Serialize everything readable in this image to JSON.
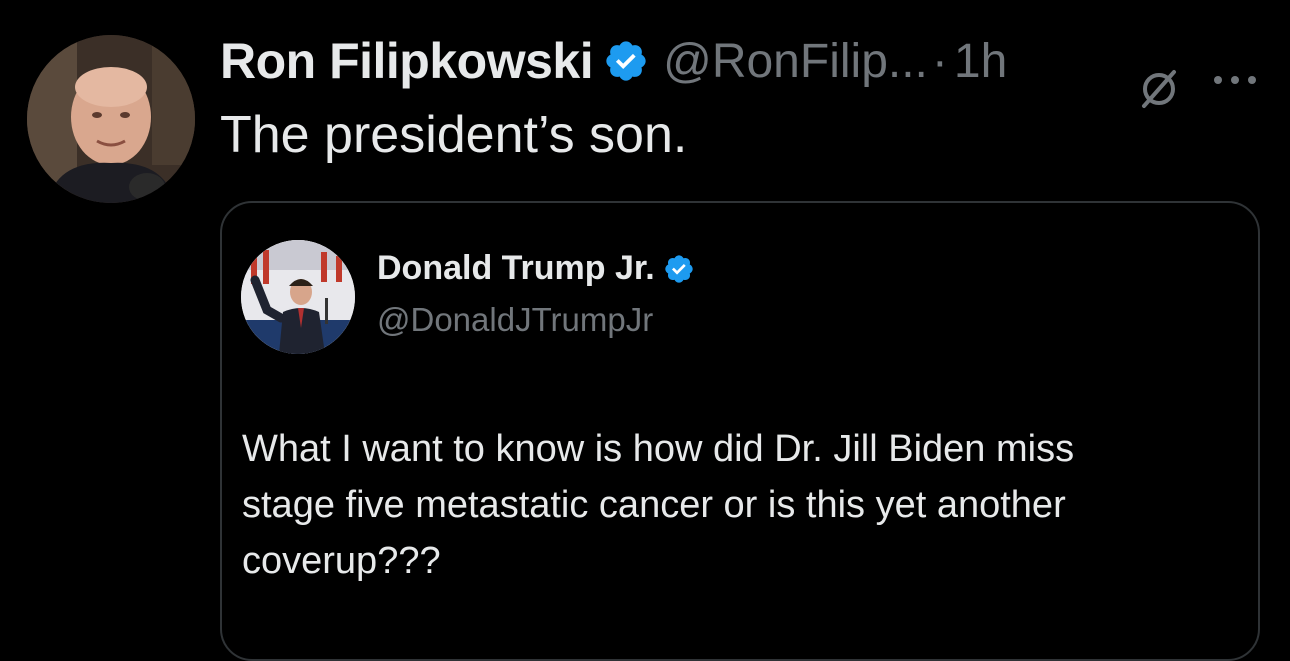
{
  "author": {
    "display_name": "Ron Filipkowski",
    "handle": "@RonFilip...",
    "separator": "·",
    "time": "1h"
  },
  "tweet": {
    "text": "The president’s son."
  },
  "quoted": {
    "display_name": "Donald Trump Jr.",
    "handle": "@DonaldJTrumpJr",
    "text_lines": [
      "What I want to know is how did Dr. Jill Biden miss",
      "stage five metastatic cancer or is this yet another",
      "coverup???"
    ]
  },
  "icons": {
    "verified": "verified-badge-icon",
    "grok": "grok-icon",
    "more": "more-options-icon"
  },
  "colors": {
    "background": "#000000",
    "primary_text": "#e7e9ea",
    "secondary_text": "#71767b",
    "verified_blue": "#1d9bf0",
    "card_border": "#2f3336"
  }
}
